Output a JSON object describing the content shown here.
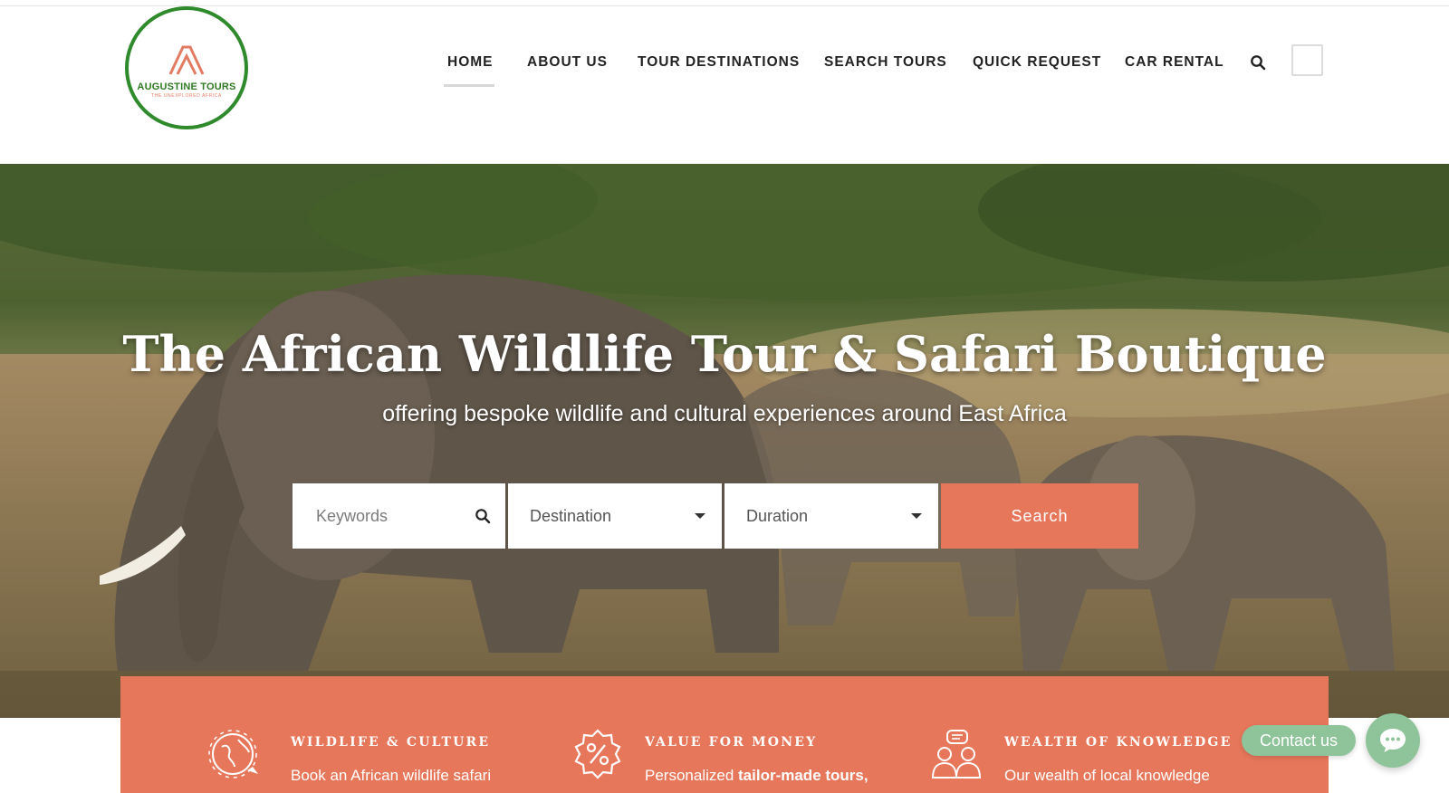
{
  "brand": {
    "name": "AUGUSTINE TOURS",
    "tagline": "THE UNEXPLORED AFRICA",
    "colors": {
      "accent": "#e7775b",
      "logo_green": "#2f8a2c",
      "contact_green": "#8fc49a"
    }
  },
  "nav": {
    "items": [
      {
        "label": "HOME",
        "active": true
      },
      {
        "label": "ABOUT US",
        "active": false
      },
      {
        "label": "TOUR DESTINATIONS",
        "active": false
      },
      {
        "label": "SEARCH TOURS",
        "active": false
      },
      {
        "label": "QUICK REQUEST",
        "active": false
      },
      {
        "label": "CAR RENTAL",
        "active": false
      }
    ],
    "search_icon": "search-icon"
  },
  "hero": {
    "title": "The African Wildlife Tour & Safari Boutique",
    "subtitle": "offering bespoke wildlife and cultural experiences around East Africa"
  },
  "search": {
    "keywords_placeholder": "Keywords",
    "destination_label": "Destination",
    "duration_label": "Duration",
    "button_label": "Search"
  },
  "features": [
    {
      "icon": "globe-icon",
      "title": "WILDLIFE & CULTURE",
      "text": "Book an African wildlife safari"
    },
    {
      "icon": "percent-badge-icon",
      "title": "VALUE FOR MONEY",
      "text_prefix": "Personalized ",
      "text_bold": "tailor-made tours,"
    },
    {
      "icon": "people-chat-icon",
      "title": "WEALTH OF KNOWLEDGE",
      "text": "Our wealth of local knowledge"
    }
  ],
  "contact": {
    "label": "Contact us",
    "icon": "chat-bubble-icon"
  }
}
